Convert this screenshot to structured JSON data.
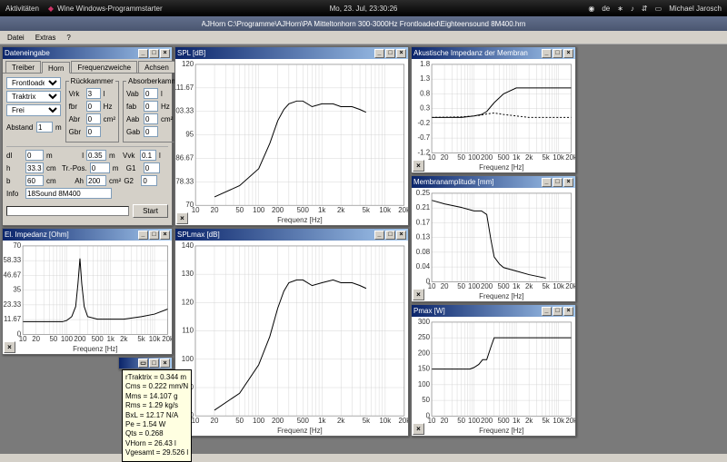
{
  "top": {
    "activities": "Aktivitäten",
    "app": "Wine Windows-Programmstarter",
    "date": "Mo, 23. Jul, 23:30:26",
    "lang": "de",
    "user": "Michael Jarosch"
  },
  "titlebar": "AJHorn  C:\\Programme\\AJHorn\\PA Mitteltonhorn 300-3000Hz Frontloaded\\Eighteensound 8M400.hrn",
  "menu": {
    "datei": "Datei",
    "extras": "Extras",
    "help": "?"
  },
  "datainput": {
    "title": "Dateneingabe",
    "tabs": {
      "treiber": "Treiber",
      "horn": "Horn",
      "freq": "Frequenzweiche",
      "achsen": "Achsen"
    },
    "groups": {
      "ruck": "Rückkammer",
      "absorb": "Absorberkammer"
    },
    "sel": {
      "opt1": "Frontloaded",
      "opt2": "Traktrix",
      "opt3": "Frei"
    },
    "labels": {
      "abstand": "Abstand",
      "vrk": "Vrk",
      "fbr": "fbr",
      "abr": "Abr",
      "gbr": "Gbr",
      "vab": "Vab",
      "fab": "fab",
      "aab": "Aab",
      "gab": "Gab",
      "dl": "dl",
      "h": "h",
      "b": "b",
      "ll": "l",
      "trpos": "Tr.-Pos.",
      "ah": "Ah",
      "vvk": "Vvk",
      "g1": "G1",
      "g2": "G2",
      "info": "Info"
    },
    "vals": {
      "abstand": "1",
      "vrk": "3",
      "fbr": "0",
      "abr": "0",
      "gbr": "0",
      "vab": "0",
      "fab": "0",
      "aab": "0",
      "gab": "0",
      "dl": "0",
      "h": "33.3",
      "b": "60",
      "ll": "0.35",
      "trpos": "0",
      "ah": "200",
      "vvk": "0.1",
      "g1": "0",
      "g2": "0",
      "info": "18Sound 8M400"
    },
    "units": {
      "m": "m",
      "cm": "cm",
      "l": "l",
      "hz": "Hz",
      "cm2": "cm²"
    },
    "start": "Start"
  },
  "charts": {
    "spl": {
      "title": "SPL [dB]",
      "xlabel": "Frequenz [Hz]"
    },
    "splmax": {
      "title": "SPLmax [dB]",
      "xlabel": "Frequenz [Hz]"
    },
    "elimp": {
      "title": "El. Impedanz [Ohm]",
      "xlabel": "Frequenz [Hz]"
    },
    "acimp": {
      "title": "Akustische Impedanz der Membran",
      "xlabel": "Frequenz [Hz]"
    },
    "mem": {
      "title": "Membranamplitude [mm]",
      "xlabel": "Frequenz [Hz]"
    },
    "pmax": {
      "title": "Pmax [W]",
      "xlabel": "Frequenz [Hz]"
    },
    "xtk": [
      "10",
      "20",
      "50",
      "100",
      "200",
      "500",
      "1k",
      "2k",
      "5k",
      "10k",
      "20k"
    ]
  },
  "chart_data": [
    {
      "type": "line",
      "title": "SPL [dB]",
      "xlabel": "Frequenz [Hz]",
      "ylabel": "",
      "ylim": [
        70,
        120
      ],
      "xscale": "log",
      "xlim": [
        10,
        20000
      ],
      "x": [
        20,
        50,
        100,
        150,
        200,
        250,
        300,
        400,
        500,
        700,
        1000,
        1500,
        2000,
        3000,
        4000,
        5000
      ],
      "values": [
        73,
        77,
        83,
        92,
        100,
        104,
        106,
        107,
        107,
        105,
        106,
        106,
        105,
        105,
        104,
        103
      ]
    },
    {
      "type": "line",
      "title": "SPLmax [dB]",
      "xlabel": "Frequenz [Hz]",
      "ylabel": "",
      "ylim": [
        80,
        140
      ],
      "xscale": "log",
      "xlim": [
        10,
        20000
      ],
      "x": [
        20,
        50,
        100,
        150,
        200,
        250,
        300,
        400,
        500,
        700,
        1000,
        1500,
        2000,
        3000,
        4000,
        5000
      ],
      "values": [
        82,
        88,
        98,
        108,
        118,
        124,
        127,
        128,
        128,
        126,
        127,
        128,
        127,
        127,
        126,
        125
      ]
    },
    {
      "type": "line",
      "title": "El. Impedanz [Ohm]",
      "xlabel": "Frequenz [Hz]",
      "ylabel": "",
      "ylim": [
        0,
        70
      ],
      "xscale": "log",
      "xlim": [
        10,
        20000
      ],
      "x": [
        10,
        20,
        50,
        80,
        100,
        130,
        160,
        180,
        200,
        220,
        250,
        300,
        500,
        1000,
        2000,
        5000,
        10000,
        20000
      ],
      "values": [
        10,
        10,
        10,
        10,
        11,
        14,
        22,
        40,
        60,
        40,
        22,
        14,
        12,
        12,
        12,
        14,
        16,
        20
      ]
    },
    {
      "type": "line",
      "title": "Akustische Impedanz der Membran",
      "xlabel": "Frequenz [Hz]",
      "ylabel": "",
      "ylim": [
        -1.2,
        1.8
      ],
      "xscale": "log",
      "xlim": [
        10,
        20000
      ],
      "series": [
        {
          "name": "real",
          "x": [
            10,
            50,
            100,
            150,
            200,
            300,
            500,
            1000,
            2000,
            5000,
            10000,
            20000
          ],
          "values": [
            0,
            0,
            0.05,
            0.1,
            0.2,
            0.5,
            0.8,
            1.0,
            1.0,
            1.0,
            1.0,
            1.0
          ]
        },
        {
          "name": "imag",
          "x": [
            10,
            50,
            100,
            150,
            200,
            300,
            500,
            1000,
            2000,
            5000,
            10000,
            20000
          ],
          "values": [
            0,
            0.02,
            0.05,
            0.08,
            0.12,
            0.15,
            0.1,
            0.05,
            0.0,
            0.0,
            0.0,
            0.0
          ]
        }
      ]
    },
    {
      "type": "line",
      "title": "Membranamplitude [mm]",
      "xlabel": "Frequenz [Hz]",
      "ylabel": "",
      "ylim": [
        0,
        0.25
      ],
      "xscale": "log",
      "xlim": [
        10,
        20000
      ],
      "x": [
        10,
        20,
        50,
        100,
        150,
        200,
        250,
        300,
        400,
        500,
        1000,
        2000,
        5000
      ],
      "values": [
        0.23,
        0.22,
        0.21,
        0.2,
        0.2,
        0.19,
        0.12,
        0.07,
        0.05,
        0.04,
        0.03,
        0.02,
        0.01
      ]
    },
    {
      "type": "line",
      "title": "Pmax [W]",
      "xlabel": "Frequenz [Hz]",
      "ylabel": "",
      "ylim": [
        0,
        300
      ],
      "xscale": "log",
      "xlim": [
        10,
        20000
      ],
      "x": [
        10,
        20,
        50,
        80,
        100,
        130,
        160,
        200,
        250,
        300,
        400,
        500,
        1000,
        2000,
        5000,
        10000,
        20000
      ],
      "values": [
        150,
        150,
        150,
        150,
        155,
        165,
        180,
        180,
        220,
        250,
        250,
        250,
        250,
        250,
        250,
        250,
        250
      ]
    }
  ],
  "tooltip": {
    "l1": "rTraktrix = 0.344 m",
    "l2": "Cms = 0.222 mm/N",
    "l3": "Mms = 14.107 g",
    "l4": "Rms = 1.29 kg/s",
    "l5": "BxL = 12.17 N/A",
    "l6": "Pe = 1.54 W",
    "l7": "Qts = 0.268",
    "l8": "VHorn = 26.43 l",
    "l9": "Vgesamt = 29.526 l"
  }
}
